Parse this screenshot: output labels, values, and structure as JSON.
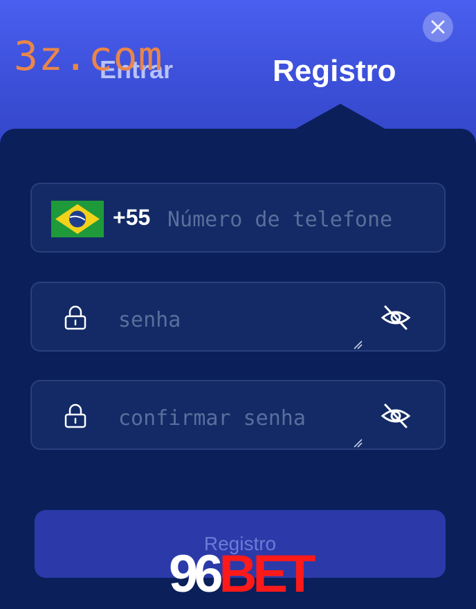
{
  "watermark": "3z.com",
  "tabs": {
    "login": "Entrar",
    "register": "Registro"
  },
  "close_icon": "close-icon",
  "phone": {
    "dial_code": "+55",
    "placeholder": "Número de telefone",
    "value": "",
    "flag": "brazil-flag-icon"
  },
  "password": {
    "placeholder": "senha",
    "value": "",
    "lock_icon": "lock-icon",
    "eye_icon": "eye-off-icon"
  },
  "confirm_password": {
    "placeholder": "confirmar senha",
    "value": "",
    "lock_icon": "lock-icon",
    "eye_icon": "eye-off-icon"
  },
  "submit_label": "Registro",
  "brand": {
    "part1": "96",
    "part2": "BET"
  },
  "colors": {
    "header_top": "#4a5ff0",
    "panel": "#0b1f5b",
    "field_bg": "#132a66",
    "field_border": "#2b3f7d",
    "button": "#2b3aa8",
    "watermark": "#e9864a",
    "brand_red": "#ff1a1a"
  }
}
